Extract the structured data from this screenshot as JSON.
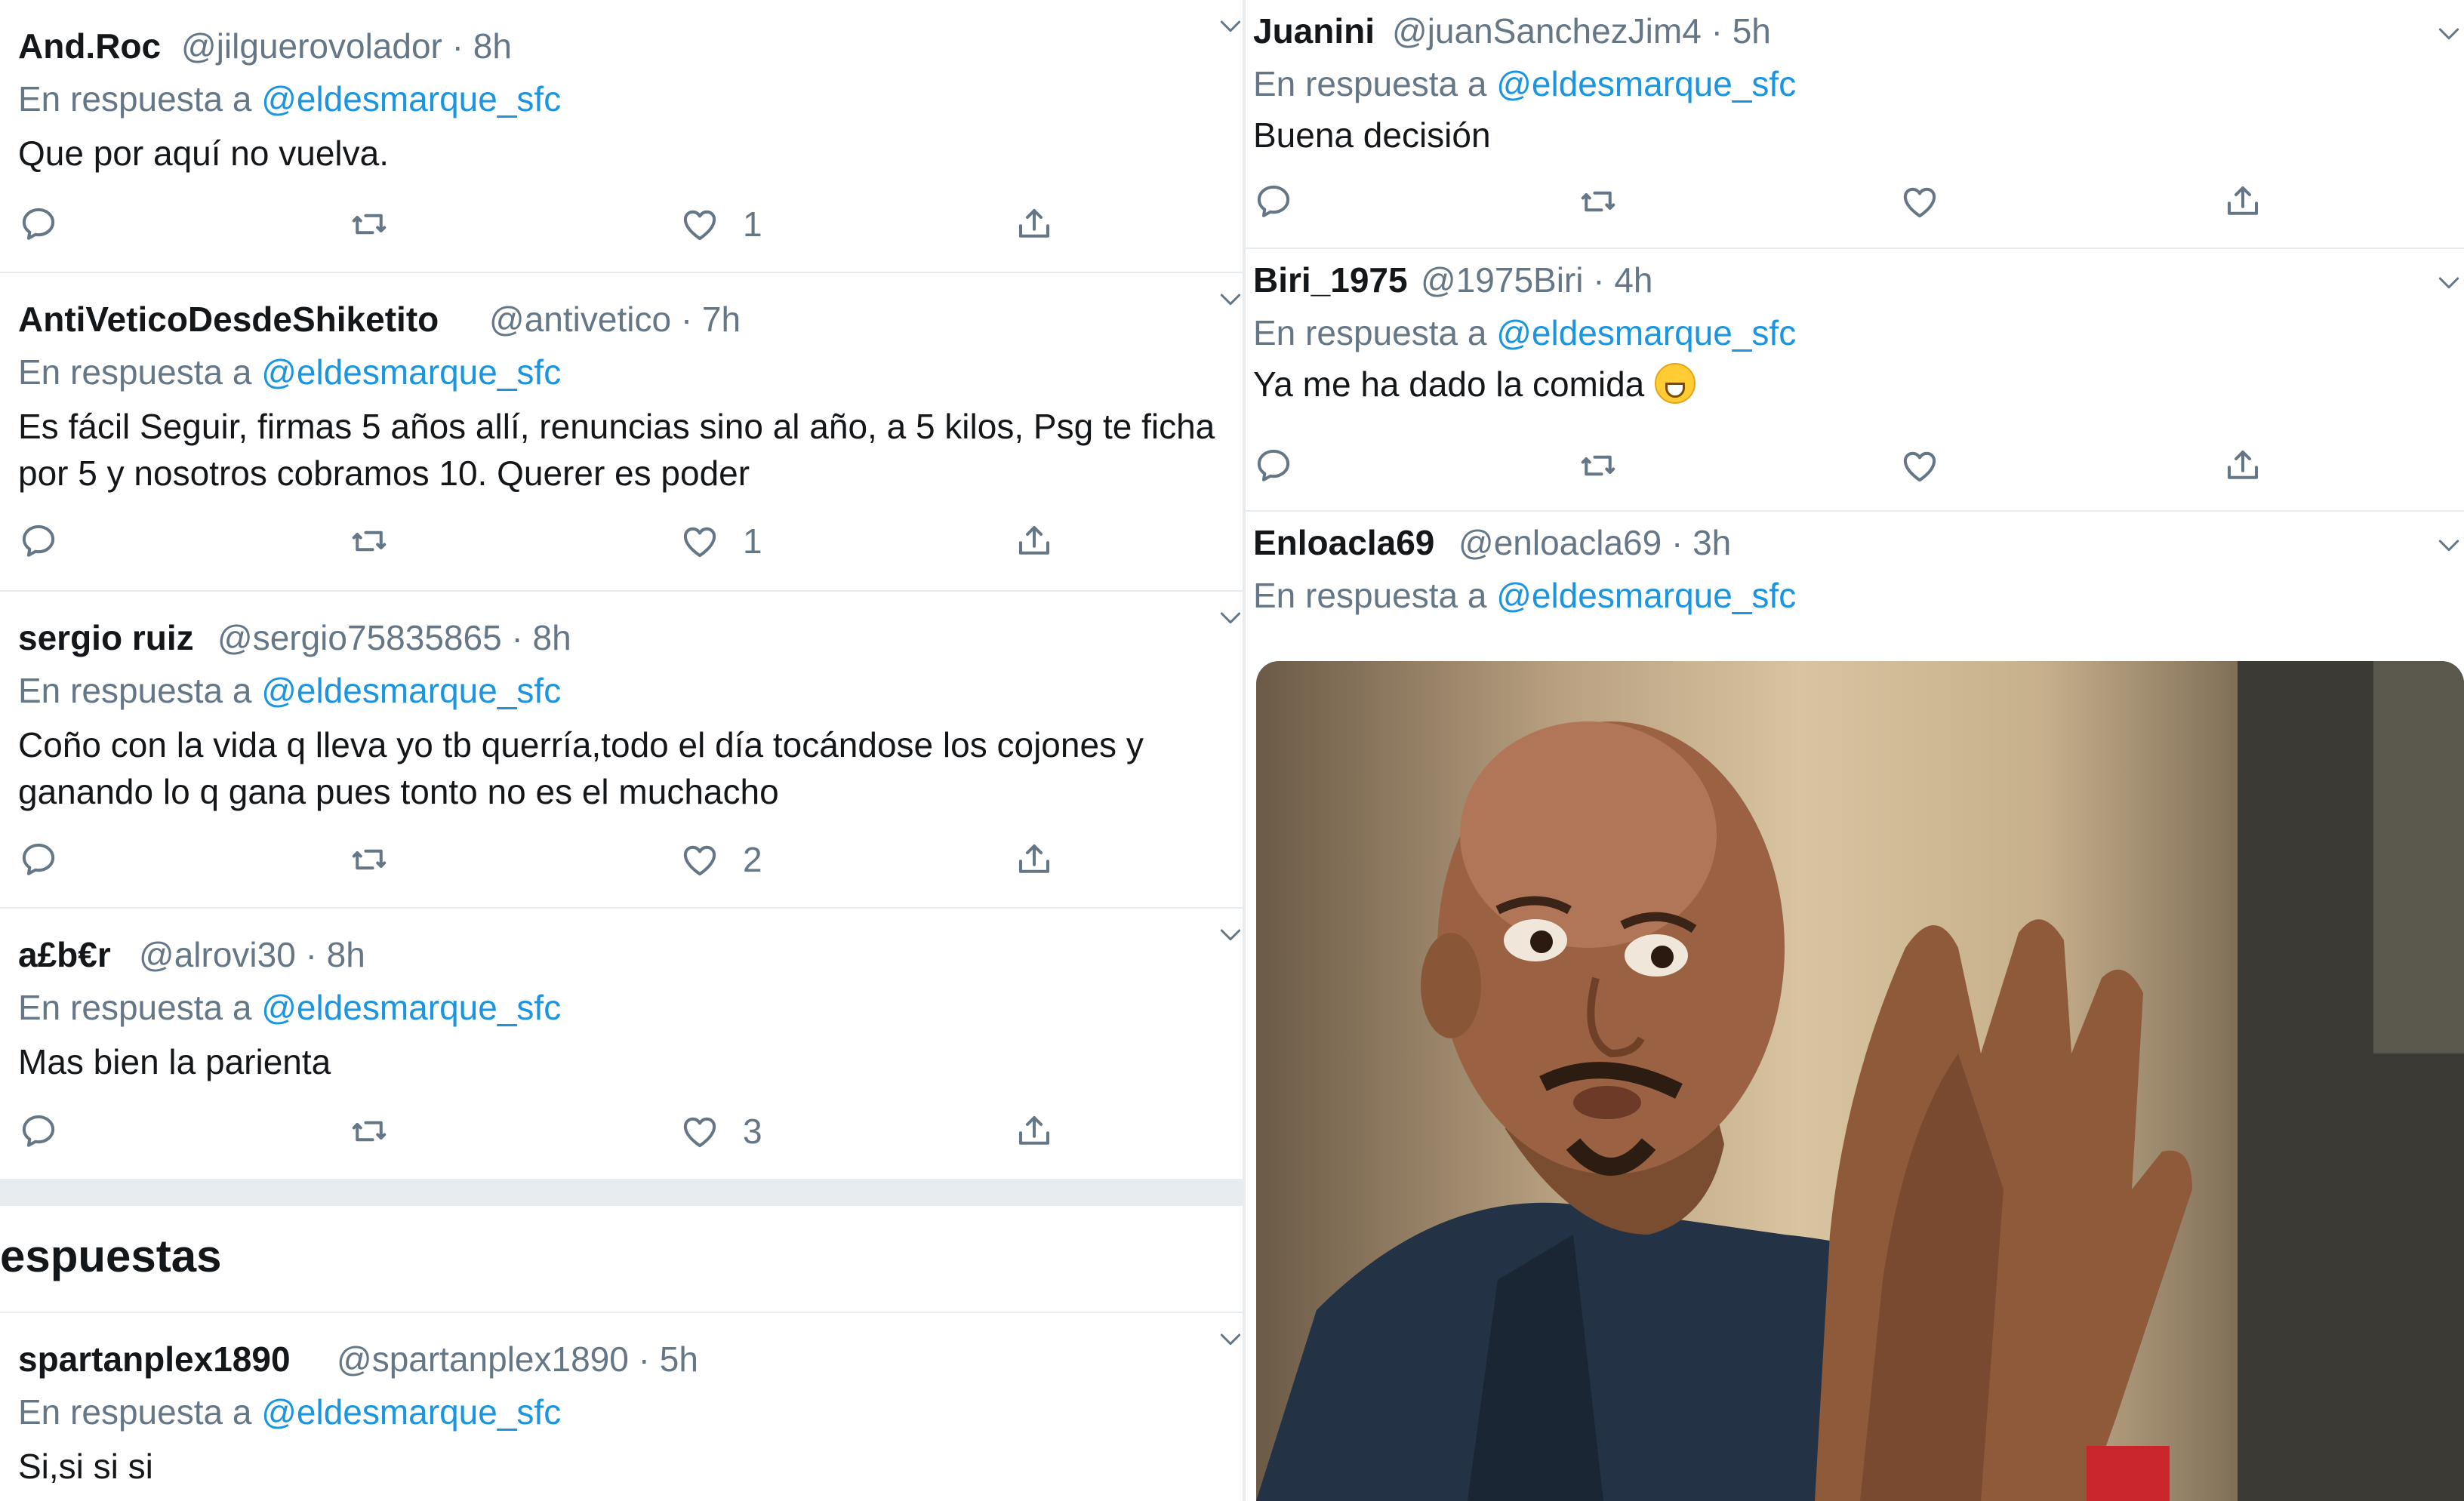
{
  "reply_prefix": "En respuesta a",
  "left_tweets": [
    {
      "name": "And.Roc",
      "handle": "@jilguerovolador",
      "time": "· 8h",
      "mention": "@eldesmarque_sfc",
      "text": "Que por aquí no vuelva.",
      "likes": "1"
    },
    {
      "name": "AntiVeticoDesdeShiketito",
      "handle": "@antivetico",
      "time": "· 7h",
      "mention": "@eldesmarque_sfc",
      "text": "Es fácil Seguir, firmas 5 años allí, renuncias sino al año,  a 5 kilos, Psg te ficha por 5 y nosotros cobramos 10. Querer es poder",
      "likes": "1"
    },
    {
      "name": "sergio ruiz",
      "handle": "@sergio75835865",
      "time": "· 8h",
      "mention": "@eldesmarque_sfc",
      "text": "Coño con la vida q lleva yo tb querría,todo el día tocándose los cojones y ganando lo q gana pues tonto no es el muchacho",
      "likes": "2"
    },
    {
      "name": "a£b€r",
      "handle": "@alrovi30",
      "time": "· 8h",
      "mention": "@eldesmarque_sfc",
      "text": "Mas bien la parienta",
      "likes": "3"
    },
    {
      "name": "spartanplex1890",
      "handle": "@spartanplex1890",
      "time": "· 5h",
      "mention": "@eldesmarque_sfc",
      "text": "Si,si si si"
    }
  ],
  "section_title": "espuestas",
  "right_tweets": [
    {
      "name": "Juanini",
      "handle": "@juanSanchezJim4",
      "time": "· 5h",
      "mention": "@eldesmarque_sfc",
      "text": "Buena decisión"
    },
    {
      "name": "Biri_1975",
      "handle": "@1975Biri",
      "time": "· 4h",
      "mention": "@eldesmarque_sfc",
      "text": "Ya me ha dado la comida"
    },
    {
      "name": "Enloacla69",
      "handle": "@enloacla69",
      "time": "· 3h",
      "mention": "@eldesmarque_sfc"
    }
  ],
  "icons": {
    "reply": "reply-icon",
    "retweet": "retweet-icon",
    "like": "heart-icon",
    "share": "share-icon",
    "caret": "chevron-down-icon",
    "emoji": "grinning-emoji"
  },
  "colors": {
    "link": "#1b95e0",
    "secondary": "#657786",
    "text": "#14171a",
    "divider": "#e6ecf0"
  }
}
